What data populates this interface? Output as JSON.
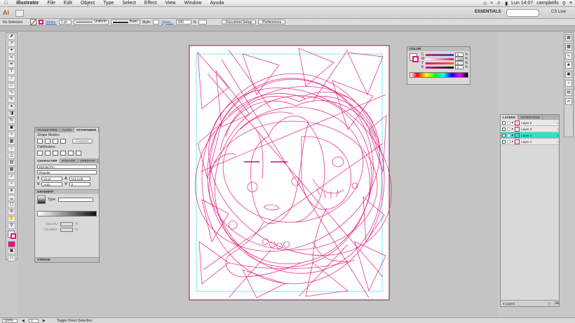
{
  "menubar": {
    "app": "Illustrator",
    "items": [
      "File",
      "Edit",
      "Object",
      "Type",
      "Select",
      "Effect",
      "View",
      "Window",
      "Ayuda"
    ],
    "clock": "Lun 14:07",
    "user": "campbells"
  },
  "appbar": {
    "logo": "Ai",
    "workspace": "ESSENTIALS",
    "cslive": "CS Live"
  },
  "control": {
    "selection": "No Selection",
    "stroke_label": "Stroke:",
    "stroke_weight": "1 pt",
    "profile": "Uniform",
    "brush": "Basic",
    "style_label": "Style:",
    "opacity_label": "Opaci...",
    "opacity": "100",
    "percent": "%",
    "doc_setup": "Document Setup",
    "preferences": "Preferences"
  },
  "panels": {
    "transform": {
      "tabs": [
        "TRANSFORM",
        "ALIGN",
        "PATHFINDER"
      ],
      "shape_modes": "Shape Modes:",
      "expand": "Expand",
      "pathfinders": "Pathfinders:"
    },
    "character": {
      "tabs": [
        "CHARACTER",
        "PARAGR",
        "OPENTYP"
      ],
      "font": "Myriad Pro",
      "style": "Regular",
      "size": "12 pt",
      "leading": "(14.4 pt)",
      "kerning": "Auto",
      "tracking": "0"
    },
    "gradient": {
      "title": "GRADIENT",
      "type_label": "Type:",
      "opacity_label": "Opacity:",
      "location_label": "Location:",
      "percent": "%"
    },
    "stroke_title": "STROKE",
    "color": {
      "title": "COLOR",
      "channels": [
        {
          "label": "C",
          "value": "0"
        },
        {
          "label": "M",
          "value": "100"
        },
        {
          "label": "Y",
          "value": "0"
        },
        {
          "label": "K",
          "value": "0"
        }
      ],
      "percent": "%"
    },
    "layers": {
      "tabs": [
        "LAYERS",
        "ARTBOARDS"
      ],
      "rows": [
        {
          "name": "Layer 2",
          "selected": false
        },
        {
          "name": "Layer 3",
          "selected": false
        },
        {
          "name": "Layer 4",
          "selected": true
        },
        {
          "name": "Layer 1",
          "selected": false
        }
      ],
      "count": "4 Layers"
    }
  },
  "status": {
    "zoom": "100%",
    "page": "1",
    "mode": "Toggle Direct Selection"
  },
  "colors": {
    "accent": "#e0157a",
    "selection_cyan": "#27e7c4",
    "artboard_border": "#7a1f3c"
  },
  "icons": [
    "apple-icon",
    "wifi-icon",
    "battery-icon",
    "search-icon",
    "selection-tool-icon",
    "direct-selection-icon",
    "pen-tool-icon",
    "type-tool-icon",
    "brush-icon",
    "zoom-icon"
  ]
}
